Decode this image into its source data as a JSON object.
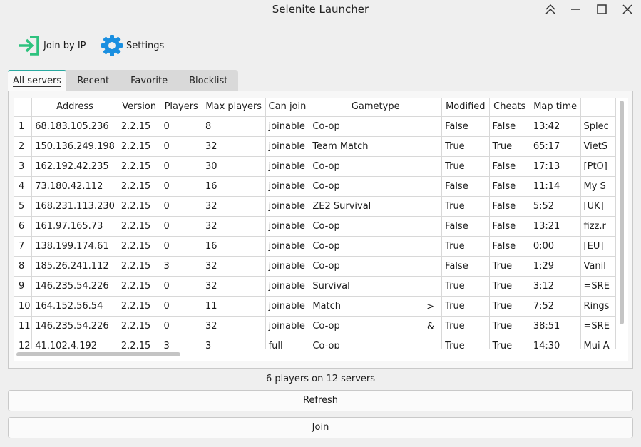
{
  "window": {
    "title": "Selenite Launcher"
  },
  "toolbar": {
    "join_by_ip": "Join by IP",
    "settings": "Settings"
  },
  "tabs": [
    "All servers",
    "Recent",
    "Favorite",
    "Blocklist"
  ],
  "columns": [
    "",
    "Address",
    "Version",
    "Players",
    "Max players",
    "Can join",
    "Gametype",
    "Modified",
    "Cheats",
    "Map time",
    ""
  ],
  "rows": [
    [
      "1",
      "68.183.105.236",
      "2.2.15",
      "0",
      "8",
      "joinable",
      "Co-op",
      "",
      "False",
      "False",
      "13:42",
      "Splec"
    ],
    [
      "2",
      "150.136.249.198",
      "2.2.15",
      "0",
      "32",
      "joinable",
      "Team Match",
      "",
      "True",
      "True",
      "65:17",
      "VietS"
    ],
    [
      "3",
      "162.192.42.235",
      "2.2.15",
      "0",
      "30",
      "joinable",
      "Co-op",
      "",
      "True",
      "False",
      "17:13",
      "[PtO]"
    ],
    [
      "4",
      "73.180.42.112",
      "2.2.15",
      "0",
      "16",
      "joinable",
      "Co-op",
      "",
      "False",
      "False",
      "11:14",
      "My S"
    ],
    [
      "5",
      "168.231.113.230",
      "2.2.15",
      "0",
      "32",
      "joinable",
      "ZE2 Survival",
      "",
      "True",
      "False",
      "5:52",
      "[UK]"
    ],
    [
      "6",
      "161.97.165.73",
      "2.2.15",
      "0",
      "32",
      "joinable",
      "Co-op",
      "",
      "False",
      "False",
      "13:21",
      "fizz.r"
    ],
    [
      "7",
      "138.199.174.61",
      "2.2.15",
      "0",
      "16",
      "joinable",
      "Co-op",
      "",
      "True",
      "False",
      "0:00",
      "[EU]"
    ],
    [
      "8",
      "185.26.241.112",
      "2.2.15",
      "3",
      "32",
      "joinable",
      "Co-op",
      "",
      "False",
      "True",
      "1:29",
      "Vanil"
    ],
    [
      "9",
      "146.235.54.226",
      "2.2.15",
      "0",
      "32",
      "joinable",
      "Survival",
      "",
      "True",
      "True",
      "3:12",
      "=SRE"
    ],
    [
      "10",
      "164.152.56.54",
      "2.2.15",
      "0",
      "11",
      "joinable",
      "Match",
      ">",
      "True",
      "True",
      "7:52",
      "Rings"
    ],
    [
      "11",
      "146.235.54.226",
      "2.2.15",
      "0",
      "32",
      "joinable",
      "Co-op",
      "&",
      "True",
      "True",
      "38:51",
      "=SRE"
    ],
    [
      "12",
      "41.102.4.192",
      "2.2.15",
      "3",
      "3",
      "full",
      "Co-op",
      "",
      "True",
      "True",
      "14:30",
      "Mui A"
    ]
  ],
  "status_text": "6 players on 12 servers",
  "buttons": {
    "refresh": "Refresh",
    "join": "Join"
  },
  "icons": {
    "join": "login-arrow-icon",
    "settings": "gear-icon",
    "window": [
      "collapse-chevrons-icon",
      "minimize-icon",
      "maximize-icon",
      "close-icon"
    ]
  },
  "colors": {
    "join_icon": "#2ec27e",
    "settings_icon": "#1a8fe0",
    "active_tab_accent": "#2aa9a0"
  }
}
